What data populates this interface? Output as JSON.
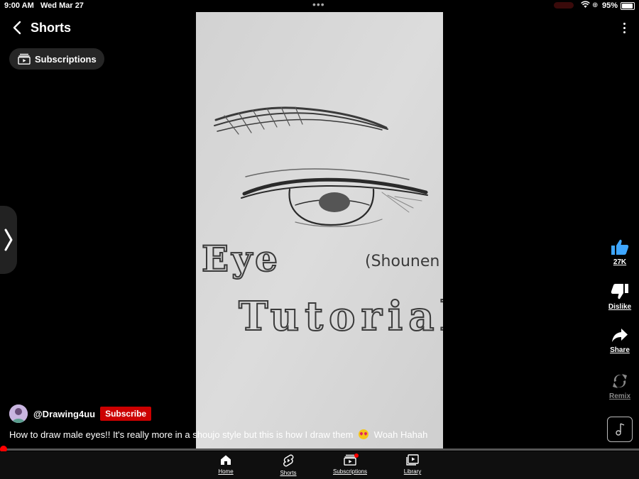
{
  "status_bar": {
    "time": "9:00 AM",
    "date": "Wed Mar 27",
    "battery": "95%"
  },
  "header": {
    "title": "Shorts"
  },
  "subscriptions_chip": {
    "label": "Subscriptions"
  },
  "video": {
    "handwriting": {
      "line1": "Eye",
      "line2": "Tutorial",
      "note": "(Shounen"
    }
  },
  "actions": {
    "like": "27K",
    "dislike": "Dislike",
    "share": "Share",
    "remix": "Remix"
  },
  "channel": {
    "handle": "@Drawing4uu",
    "subscribe_label": "Subscribe"
  },
  "caption": {
    "text_before": "How to draw male eyes!! It's really more in a shoujo style but this is how I draw them",
    "text_after": "Woah Hahah"
  },
  "progress": {
    "value": 0.005
  },
  "bottom_nav": {
    "home": "Home",
    "shorts": "Shorts",
    "subscriptions": "Subscriptions",
    "library": "Library"
  },
  "colors": {
    "accent": "#ff0000",
    "like_blue": "#3ea6ff",
    "subscribe_red": "#cc0000"
  }
}
